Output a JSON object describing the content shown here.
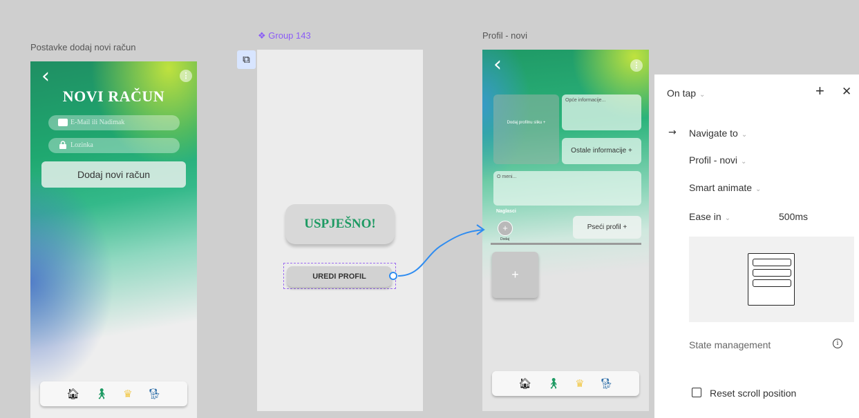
{
  "frames": {
    "frame1_title": "Postavke dodaj novi račun",
    "group_title": "Group 143",
    "frame3_title": "Profil - novi"
  },
  "frame1": {
    "heading": "NOVI RAČUN",
    "email_placeholder": "E-Mail ili Nadimak",
    "password_placeholder": "Lozinka",
    "add_button": "Dodaj novi račun",
    "back_glyph": "‹",
    "more_glyph": "⋮"
  },
  "group": {
    "success_text": "USPJEŠNO!",
    "edit_button": "UREDI PROFIL"
  },
  "frame3": {
    "photo_card": "Dodaj profilnu sliku +",
    "general_info": "Opće informacije...",
    "other_info": "Ostale informacije  +",
    "about_me": "O meni...",
    "highlights": "Naglasci",
    "add_label": "Dodaj",
    "dog_profile": "Pseći profil  +",
    "plus": "+"
  },
  "nav_icons": [
    "home-icon",
    "dog-walker-icon",
    "crown-icon",
    "dog-icon"
  ],
  "nav_glyphs": [
    "🏠︎",
    "🚶︎",
    "♛",
    "🐕︎"
  ],
  "nav_colors": [
    "#111111",
    "#1e9a63",
    "#f2c94c",
    "#2f6fa8"
  ],
  "panel": {
    "trigger": "On tap",
    "action": "Navigate to",
    "destination": "Profil - novi",
    "animation": "Smart animate",
    "easing": "Ease in",
    "duration": "500ms",
    "state_management": "State management",
    "reset_scroll": "Reset scroll position",
    "plus": "+",
    "close": "✕",
    "arrow": "→",
    "caret": "⌄"
  },
  "colors": {
    "accent_purple": "#9b6bf0",
    "connector_blue": "#2f8cf0",
    "brand_green": "#1e9a63"
  }
}
